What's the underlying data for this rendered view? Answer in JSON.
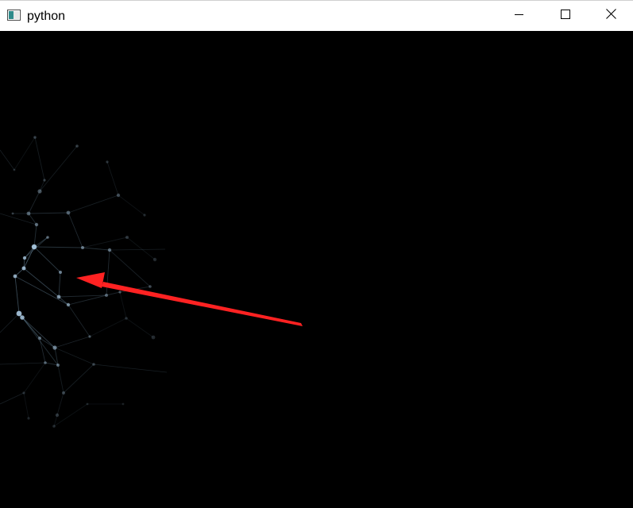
{
  "window": {
    "title": "python",
    "icon": "app-window-icon",
    "controls": {
      "minimize_icon": "minimize-icon",
      "maximize_icon": "maximize-icon",
      "close_icon": "close-icon"
    }
  },
  "canvas": {
    "background": "#000000",
    "node_color": "#a9c7df",
    "line_color": "#7fa4c0",
    "annotation_arrow_color": "#ff2222"
  }
}
